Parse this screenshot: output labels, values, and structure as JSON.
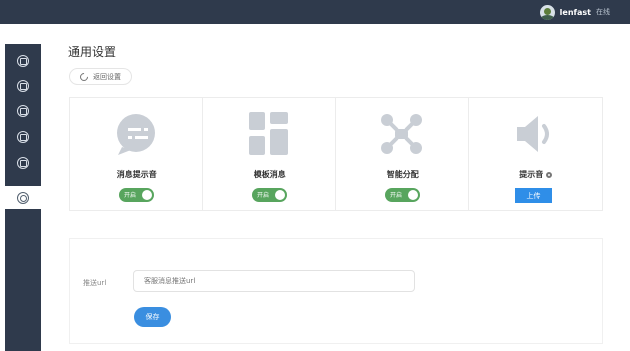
{
  "header": {
    "username": "lenfast",
    "status": "在线"
  },
  "sidebar": {
    "items": [
      {
        "icon": "home-icon"
      },
      {
        "icon": "chat-icon"
      },
      {
        "icon": "customer-icon"
      },
      {
        "icon": "user-icon"
      },
      {
        "icon": "data-icon"
      },
      {
        "icon": "settings-icon"
      }
    ],
    "active_index": 5
  },
  "page": {
    "title": "通用设置",
    "back_label": "返回设置"
  },
  "settings": [
    {
      "label": "消息提示音",
      "toggle_text": "开启",
      "enabled": true,
      "icon": "message-bubble-icon"
    },
    {
      "label": "模板消息",
      "toggle_text": "开启",
      "enabled": true,
      "icon": "template-grid-icon"
    },
    {
      "label": "智能分配",
      "toggle_text": "开启",
      "enabled": true,
      "icon": "smart-assign-icon"
    },
    {
      "label": "提示音",
      "upload_label": "上传",
      "icon": "speaker-icon"
    }
  ],
  "form": {
    "label": "推送url",
    "placeholder": "客服消息推送url",
    "save_label": "保存"
  },
  "colors": {
    "sidebar": "#2f3a4c",
    "toggle_on": "#58a55e",
    "primary": "#2f8ee8",
    "icon_gray": "#c9ced5"
  }
}
